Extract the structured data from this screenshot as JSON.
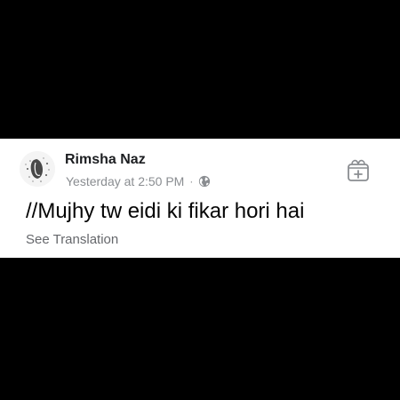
{
  "post": {
    "author": "Rimsha Naz",
    "timestamp": "Yesterday at 2:50 PM",
    "separator": "·",
    "audience_icon": "globe-icon",
    "text": "//Mujhy tw eidi ki fikar hori hai",
    "translation_link": "See Translation",
    "action_icon": "gift-icon"
  },
  "colors": {
    "background": "#000000",
    "card": "#ffffff",
    "name": "#1c1e21",
    "meta": "#8a8d91",
    "body_text": "#050505",
    "link": "#65676b"
  }
}
